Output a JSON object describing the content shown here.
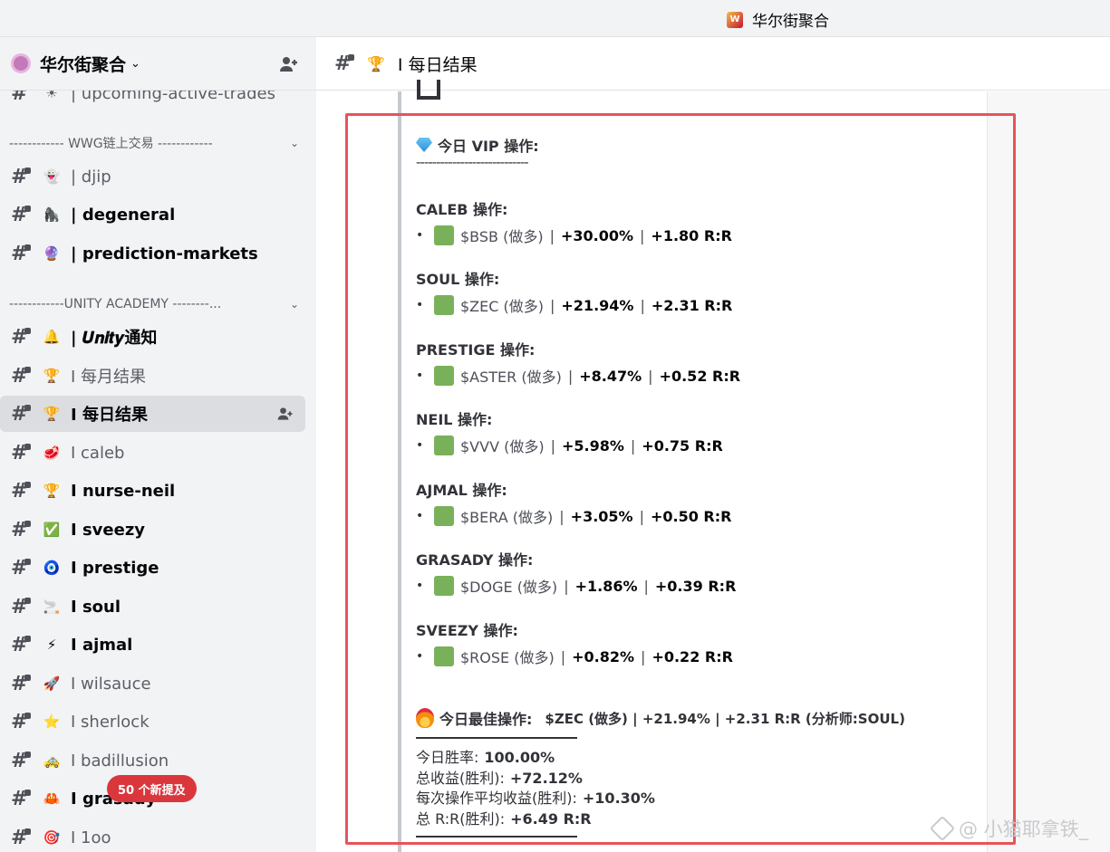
{
  "window": {
    "app_title": "华尔街聚合"
  },
  "server": {
    "name": "华尔街聚合"
  },
  "sidebar": {
    "categories": [
      {
        "label": "------------ WWG链上交易 ------------"
      },
      {
        "label": "------------UNITY ACADEMY --------..."
      }
    ],
    "channels": [
      {
        "emoji": "☀",
        "label": "| upcoming-active-trades"
      },
      {
        "emoji": "👻",
        "label": "| djip"
      },
      {
        "emoji": "🦍",
        "label": "| degeneral"
      },
      {
        "emoji": "🔮",
        "label": "| prediction-markets"
      },
      {
        "emoji": "🔔",
        "label": "| 𝑼𝒏𝒊𝒕𝒚通知"
      },
      {
        "emoji": "🏆",
        "label": "I 每月结果"
      },
      {
        "emoji": "🏆",
        "label": "I 每日结果"
      },
      {
        "emoji": "🥩",
        "label": "I caleb"
      },
      {
        "emoji": "🏆",
        "label": "I nurse-neil"
      },
      {
        "emoji": "✅",
        "label": "I sveezy"
      },
      {
        "emoji": "🧿",
        "label": "I prestige"
      },
      {
        "emoji": "🚬",
        "label": "I soul"
      },
      {
        "emoji": "⚡",
        "label": "I ajmal"
      },
      {
        "emoji": "🚀",
        "label": "I wilsauce"
      },
      {
        "emoji": "⭐",
        "label": "I sherlock"
      },
      {
        "emoji": "🚕",
        "label": "I badillusion"
      },
      {
        "emoji": "🦀",
        "label": "I grasady"
      },
      {
        "emoji": "🎯",
        "label": "I 1oo"
      }
    ],
    "new_mentions": "50 个新提及"
  },
  "channel_header": {
    "title": "I 每日结果"
  },
  "message": {
    "vip_title": "今日 VIP 操作:",
    "dash_line": "----------------------------",
    "traders": [
      {
        "name": "CALEB 操作:",
        "symbol": "$BSB (做多)",
        "pct": "+30.00%",
        "rr": "+1.80 R:R"
      },
      {
        "name": "SOUL 操作:",
        "symbol": "$ZEC (做多)",
        "pct": "+21.94%",
        "rr": "+2.31 R:R"
      },
      {
        "name": "PRESTIGE 操作:",
        "symbol": "$ASTER (做多)",
        "pct": "+8.47%",
        "rr": "+0.52 R:R"
      },
      {
        "name": "NEIL 操作:",
        "symbol": "$VVV (做多)",
        "pct": "+5.98%",
        "rr": "+0.75 R:R"
      },
      {
        "name": "AJMAL 操作:",
        "symbol": "$BERA (做多)",
        "pct": "+3.05%",
        "rr": "+0.50 R:R"
      },
      {
        "name": "GRASADY 操作:",
        "symbol": "$DOGE (做多)",
        "pct": "+1.86%",
        "rr": "+0.39 R:R"
      },
      {
        "name": "SVEEZY 操作:",
        "symbol": "$ROSE (做多)",
        "pct": "+0.82%",
        "rr": "+0.22 R:R"
      }
    ],
    "best_label": "今日最佳操作:",
    "best_body": "$ZEC (做多) | +21.94% | +2.31 R:R (分析师:SOUL)",
    "stats": [
      {
        "label": "今日胜率:",
        "value": "100.00%"
      },
      {
        "label": "总收益(胜利):",
        "value": "+72.12%"
      },
      {
        "label": "每次操作平均收益(胜利):",
        "value": "+10.30%"
      },
      {
        "label": "总 R:R(胜利):",
        "value": "+6.49 R:R"
      }
    ]
  },
  "watermark": "@ 小猫耶拿铁_",
  "colors": {
    "accent_green": "#78b159",
    "highlight_red": "#e8535a",
    "mention_red": "#da373c"
  }
}
